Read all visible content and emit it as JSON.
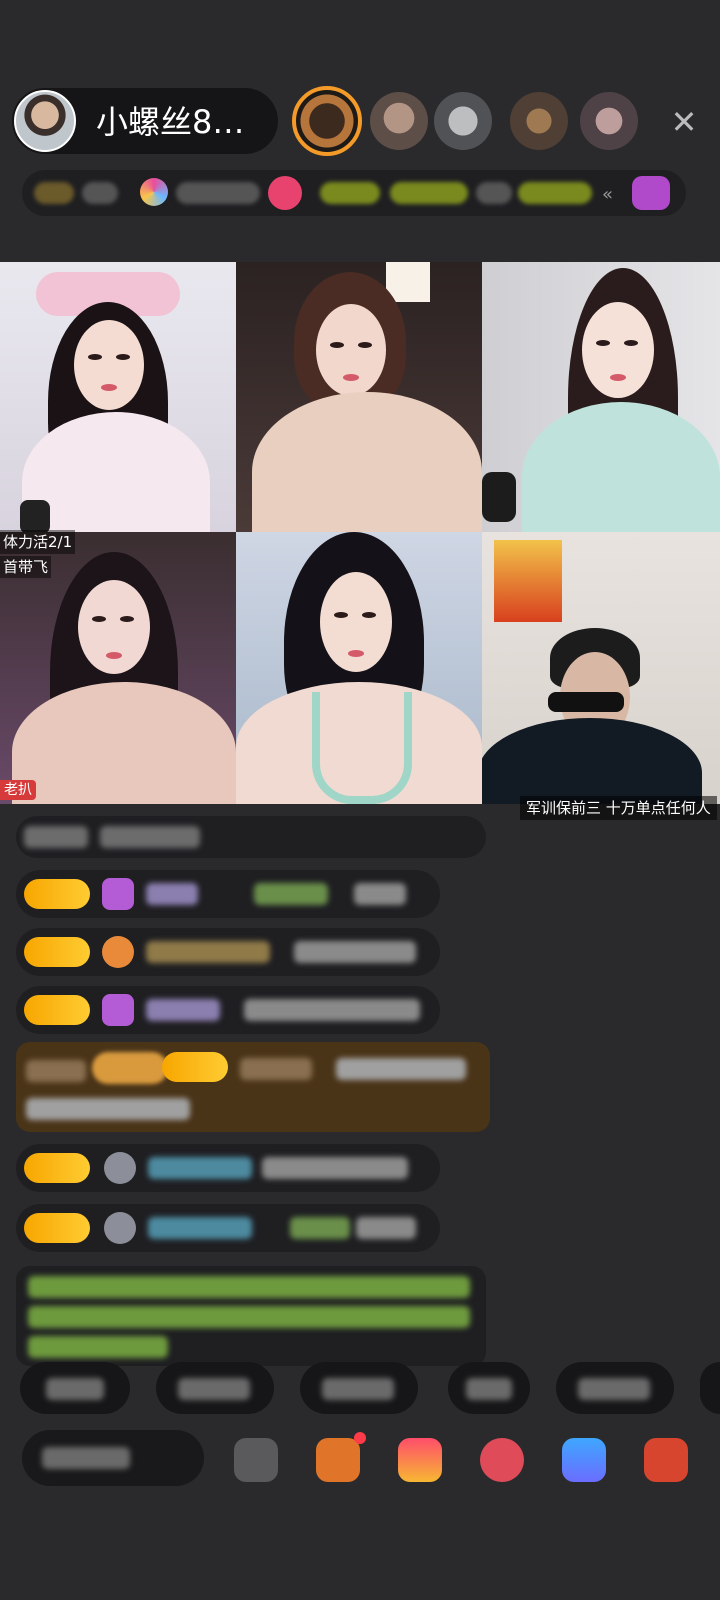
{
  "header": {
    "host_name": "小螺丝8…",
    "close_icon": "close-icon"
  },
  "grid": {
    "labels": [
      "体力活2/1",
      "首带飞",
      "老扒",
      "军训保前三  十万单点任何人"
    ]
  },
  "colors": {
    "background": "#2a2a2c",
    "badge_gold": "#f7a600",
    "chat_bg": "#1f1f22",
    "highlight_row": "#4a3418",
    "green_text": "#9bd24a",
    "accent_orange": "#f39a29"
  }
}
